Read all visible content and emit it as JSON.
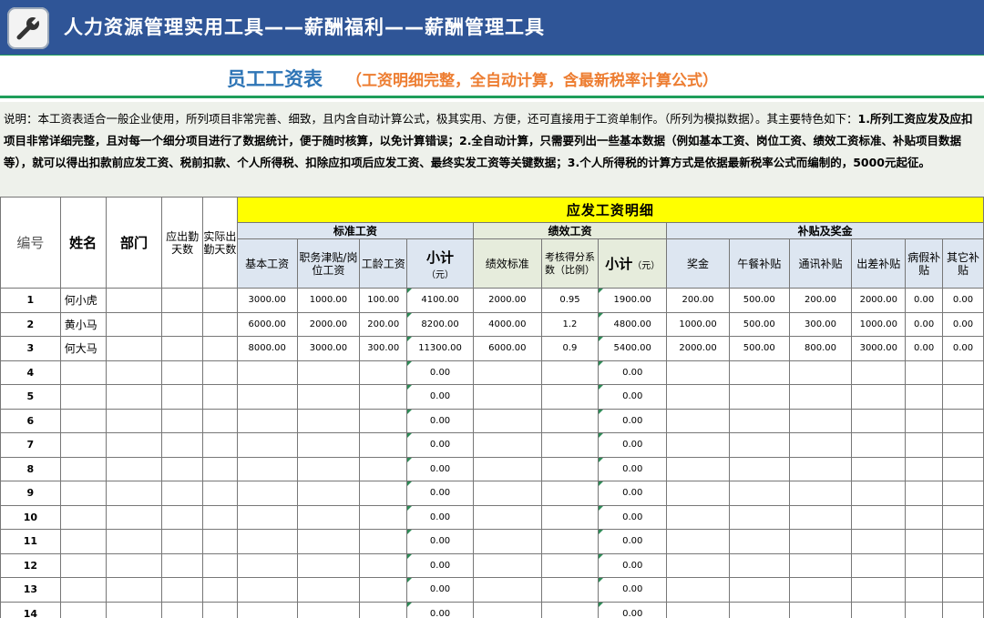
{
  "header": {
    "title": "人力资源管理实用工具——薪酬福利——薪酬管理工具",
    "icon": "wrench-icon"
  },
  "banner": {
    "title": "员工工资表",
    "subtitle": "（工资明细完整，全自动计算，含最新税率计算公式）"
  },
  "description": {
    "p1": "说明：本工资表适合一般企业使用，所列项目非常完善、细致，且内含自动计算公式，极其实用、方便，还可直接用于工资单制作。（所列为模拟数据）。其主要特色如下：",
    "p2": "1.所列工资应发及应扣项目非常详细完整，且对每一个细分项目进行了数据统计，便于随时核算，以免计算错误；2.全自动计算，只需要列出一些基本数据（例如基本工资、岗位工资、绩效工资标准、补贴项目数据等），就可以得出扣款前应发工资、税前扣款、个人所得税、扣除应扣项后应发工资、最终实发工资等关键数据；3.个人所得税的计算方式是依据最新税率公式而编制的，5000元起征。"
  },
  "table": {
    "head": {
      "id": "编号",
      "name": "姓名",
      "dept": "部门",
      "days_due": "应出勤天数",
      "days_actual": "实际出勤天数",
      "section": "应发工资明细",
      "group_std": "标准工资",
      "group_perf": "绩效工资",
      "group_allow": "补贴及奖金",
      "base": "基本工资",
      "post": "职务津贴/岗位工资",
      "seniority": "工龄工资",
      "subtotal": "小计",
      "unit": "（元）",
      "perf_std": "绩效标准",
      "perf_coef": "考核得分系数（比例）",
      "bonus": "奖金",
      "meal": "午餐补贴",
      "comm": "通讯补贴",
      "travel": "出差补贴",
      "sick": "病假补贴",
      "other": "其它补贴"
    },
    "rows": [
      {
        "no": "1",
        "name": "何小虎",
        "base": "3000.00",
        "post": "1000.00",
        "sen": "100.00",
        "sub1": "4100.00",
        "pstd": "2000.00",
        "coef": "0.95",
        "sub2": "1900.00",
        "bonus": "200.00",
        "meal": "500.00",
        "comm": "200.00",
        "travel": "2000.00",
        "sick": "0.00",
        "other": "0.00"
      },
      {
        "no": "2",
        "name": "黄小马",
        "base": "6000.00",
        "post": "2000.00",
        "sen": "200.00",
        "sub1": "8200.00",
        "pstd": "4000.00",
        "coef": "1.2",
        "sub2": "4800.00",
        "bonus": "1000.00",
        "meal": "500.00",
        "comm": "300.00",
        "travel": "1000.00",
        "sick": "0.00",
        "other": "0.00"
      },
      {
        "no": "3",
        "name": "何大马",
        "base": "8000.00",
        "post": "3000.00",
        "sen": "300.00",
        "sub1": "11300.00",
        "pstd": "6000.00",
        "coef": "0.9",
        "sub2": "5400.00",
        "bonus": "2000.00",
        "meal": "500.00",
        "comm": "800.00",
        "travel": "3000.00",
        "sick": "0.00",
        "other": "0.00"
      },
      {
        "no": "4",
        "sub1": "0.00",
        "sub2": "0.00"
      },
      {
        "no": "5",
        "sub1": "0.00",
        "sub2": "0.00"
      },
      {
        "no": "6",
        "sub1": "0.00",
        "sub2": "0.00"
      },
      {
        "no": "7",
        "sub1": "0.00",
        "sub2": "0.00"
      },
      {
        "no": "8",
        "sub1": "0.00",
        "sub2": "0.00"
      },
      {
        "no": "9",
        "sub1": "0.00",
        "sub2": "0.00"
      },
      {
        "no": "10",
        "sub1": "0.00",
        "sub2": "0.00"
      },
      {
        "no": "11",
        "sub1": "0.00",
        "sub2": "0.00"
      },
      {
        "no": "12",
        "sub1": "0.00",
        "sub2": "0.00"
      },
      {
        "no": "13",
        "sub1": "0.00",
        "sub2": "0.00"
      },
      {
        "no": "14",
        "sub1": "0.00",
        "sub2": "0.00"
      }
    ]
  }
}
